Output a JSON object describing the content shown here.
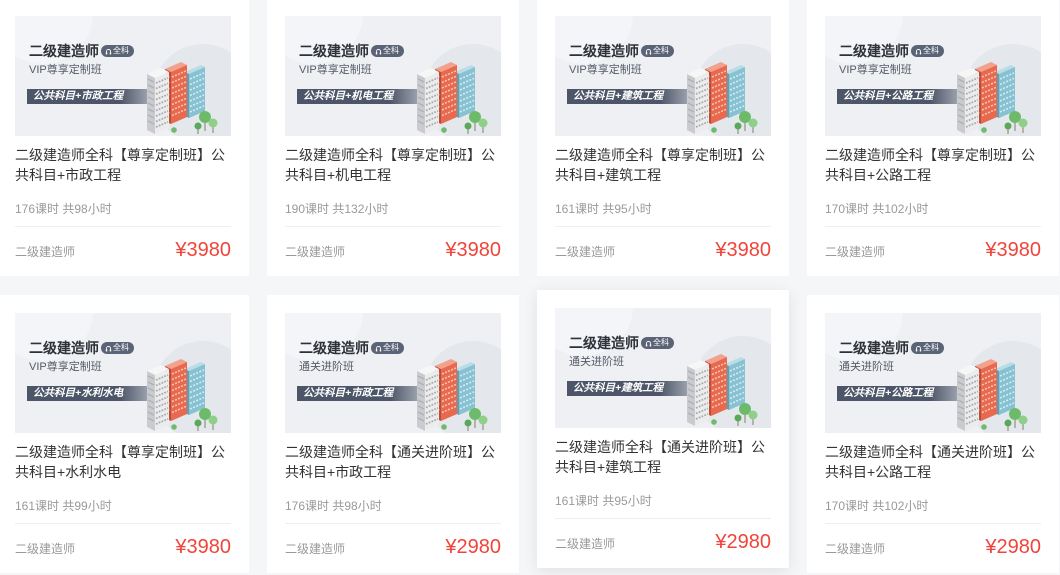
{
  "colors": {
    "page_background": "#f5f6f8",
    "title": "#333333",
    "meta": "#999999",
    "price": "#f0443a",
    "banner": "#4d5668",
    "badge": "#5b6376"
  },
  "icons": {
    "badge": "headphones-icon"
  },
  "courses": [
    {
      "thumb": {
        "brand": "二级建造师",
        "badge": "全科",
        "subtitle": "VIP尊享定制班",
        "banner": "公共科目+市政工程"
      },
      "title": "二级建造师全科【尊享定制班】公共科目+市政工程",
      "hours": "176课时 共98小时",
      "category": "二级建造师",
      "price": "¥3980"
    },
    {
      "thumb": {
        "brand": "二级建造师",
        "badge": "全科",
        "subtitle": "VIP尊享定制班",
        "banner": "公共科目+机电工程"
      },
      "title": "二级建造师全科【尊享定制班】公共科目+机电工程",
      "hours": "190课时 共132小时",
      "category": "二级建造师",
      "price": "¥3980"
    },
    {
      "thumb": {
        "brand": "二级建造师",
        "badge": "全科",
        "subtitle": "VIP尊享定制班",
        "banner": "公共科目+建筑工程"
      },
      "title": "二级建造师全科【尊享定制班】公共科目+建筑工程",
      "hours": "161课时 共95小时",
      "category": "二级建造师",
      "price": "¥3980"
    },
    {
      "thumb": {
        "brand": "二级建造师",
        "badge": "全科",
        "subtitle": "VIP尊享定制班",
        "banner": "公共科目+公路工程"
      },
      "title": "二级建造师全科【尊享定制班】公共科目+公路工程",
      "hours": "170课时 共102小时",
      "category": "二级建造师",
      "price": "¥3980"
    },
    {
      "thumb": {
        "brand": "二级建造师",
        "badge": "全科",
        "subtitle": "VIP尊享定制班",
        "banner": "公共科目+水利水电"
      },
      "title": "二级建造师全科【尊享定制班】公共科目+水利水电",
      "hours": "161课时 共99小时",
      "category": "二级建造师",
      "price": "¥3980"
    },
    {
      "thumb": {
        "brand": "二级建造师",
        "badge": "全科",
        "subtitle": "通关进阶班",
        "banner": "公共科目+市政工程"
      },
      "title": "二级建造师全科【通关进阶班】公共科目+市政工程",
      "hours": "176课时 共98小时",
      "category": "二级建造师",
      "price": "¥2980"
    },
    {
      "thumb": {
        "brand": "二级建造师",
        "badge": "全科",
        "subtitle": "通关进阶班",
        "banner": "公共科目+建筑工程"
      },
      "title": "二级建造师全科【通关进阶班】公共科目+建筑工程",
      "hours": "161课时 共95小时",
      "category": "二级建造师",
      "price": "¥2980",
      "hovered": true
    },
    {
      "thumb": {
        "brand": "二级建造师",
        "badge": "全科",
        "subtitle": "通关进阶班",
        "banner": "公共科目+公路工程"
      },
      "title": "二级建造师全科【通关进阶班】公共科目+公路工程",
      "hours": "170课时 共102小时",
      "category": "二级建造师",
      "price": "¥2980"
    }
  ]
}
